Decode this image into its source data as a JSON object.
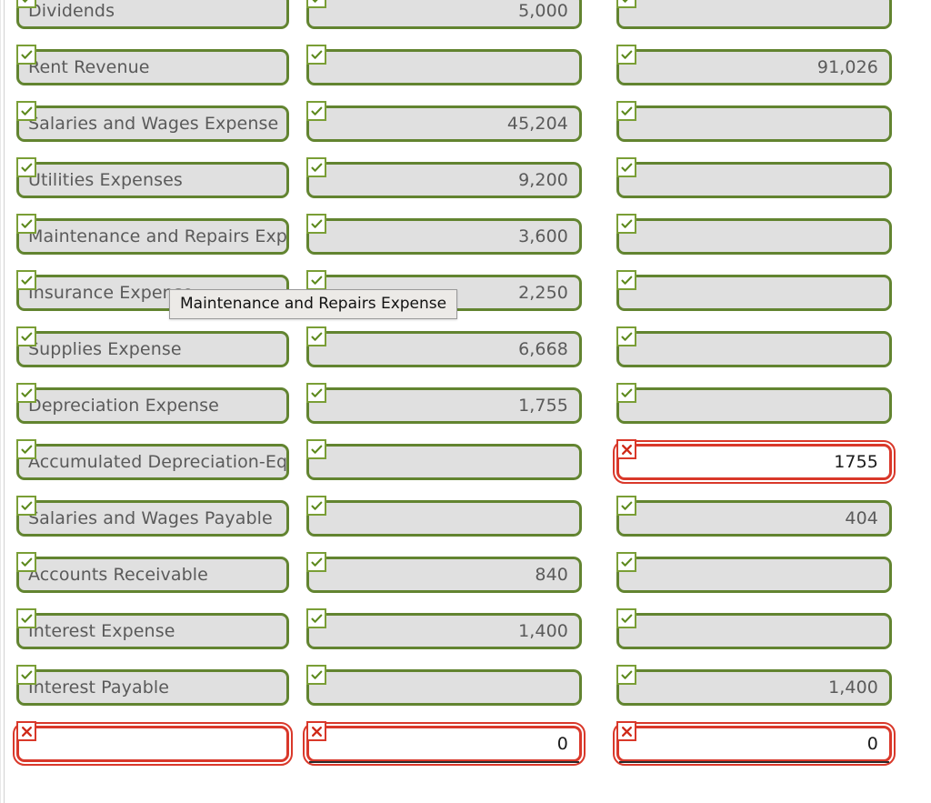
{
  "worksheet": {
    "columns": [
      "account",
      "debit",
      "credit"
    ],
    "icons": {
      "valid": "check-icon",
      "invalid": "x-icon"
    },
    "colors": {
      "valid_border": "#628430",
      "invalid_border": "#d9382a",
      "field_fill": "#e0e0e0",
      "field_text": "#5a5a5a",
      "editable_text": "#1a1a1a",
      "rule": "#2b2b2b"
    },
    "rows": [
      {
        "account": {
          "value": "Dividends",
          "status": "valid"
        },
        "debit": {
          "value": "5,000",
          "status": "valid"
        },
        "credit": {
          "value": "",
          "status": "valid"
        }
      },
      {
        "account": {
          "value": "Rent Revenue",
          "status": "valid"
        },
        "debit": {
          "value": "",
          "status": "valid"
        },
        "credit": {
          "value": "91,026",
          "status": "valid"
        }
      },
      {
        "account": {
          "value": "Salaries and Wages Expense",
          "status": "valid"
        },
        "debit": {
          "value": "45,204",
          "status": "valid"
        },
        "credit": {
          "value": "",
          "status": "valid"
        }
      },
      {
        "account": {
          "value": "Utilities Expenses",
          "status": "valid"
        },
        "debit": {
          "value": "9,200",
          "status": "valid"
        },
        "credit": {
          "value": "",
          "status": "valid"
        }
      },
      {
        "account": {
          "value": "Maintenance and Repairs Expense",
          "status": "valid"
        },
        "debit": {
          "value": "3,600",
          "status": "valid"
        },
        "credit": {
          "value": "",
          "status": "valid"
        }
      },
      {
        "account": {
          "value": "Insurance Expense",
          "status": "valid"
        },
        "debit": {
          "value": "2,250",
          "status": "valid"
        },
        "credit": {
          "value": "",
          "status": "valid"
        }
      },
      {
        "account": {
          "value": "Supplies Expense",
          "status": "valid"
        },
        "debit": {
          "value": "6,668",
          "status": "valid"
        },
        "credit": {
          "value": "",
          "status": "valid"
        }
      },
      {
        "account": {
          "value": "Depreciation Expense",
          "status": "valid"
        },
        "debit": {
          "value": "1,755",
          "status": "valid"
        },
        "credit": {
          "value": "",
          "status": "valid"
        }
      },
      {
        "account": {
          "value": "Accumulated Depreciation-Equipment",
          "status": "valid"
        },
        "debit": {
          "value": "",
          "status": "valid"
        },
        "credit": {
          "value": "1755",
          "status": "invalid"
        }
      },
      {
        "account": {
          "value": "Salaries and Wages Payable",
          "status": "valid"
        },
        "debit": {
          "value": "",
          "status": "valid"
        },
        "credit": {
          "value": "404",
          "status": "valid"
        }
      },
      {
        "account": {
          "value": "Accounts Receivable",
          "status": "valid"
        },
        "debit": {
          "value": "840",
          "status": "valid"
        },
        "credit": {
          "value": "",
          "status": "valid"
        }
      },
      {
        "account": {
          "value": "Interest Expense",
          "status": "valid"
        },
        "debit": {
          "value": "1,400",
          "status": "valid"
        },
        "credit": {
          "value": "",
          "status": "valid"
        }
      },
      {
        "account": {
          "value": "Interest Payable",
          "status": "valid"
        },
        "debit": {
          "value": "",
          "status": "valid"
        },
        "credit": {
          "value": "1,400",
          "status": "valid"
        }
      },
      {
        "account": {
          "value": "",
          "status": "invalid"
        },
        "debit": {
          "value": "0",
          "status": "invalid",
          "rule_below": true
        },
        "credit": {
          "value": "0",
          "status": "invalid",
          "rule_below": true
        }
      }
    ]
  },
  "tooltip": {
    "text": "Maintenance and Repairs Expense"
  }
}
